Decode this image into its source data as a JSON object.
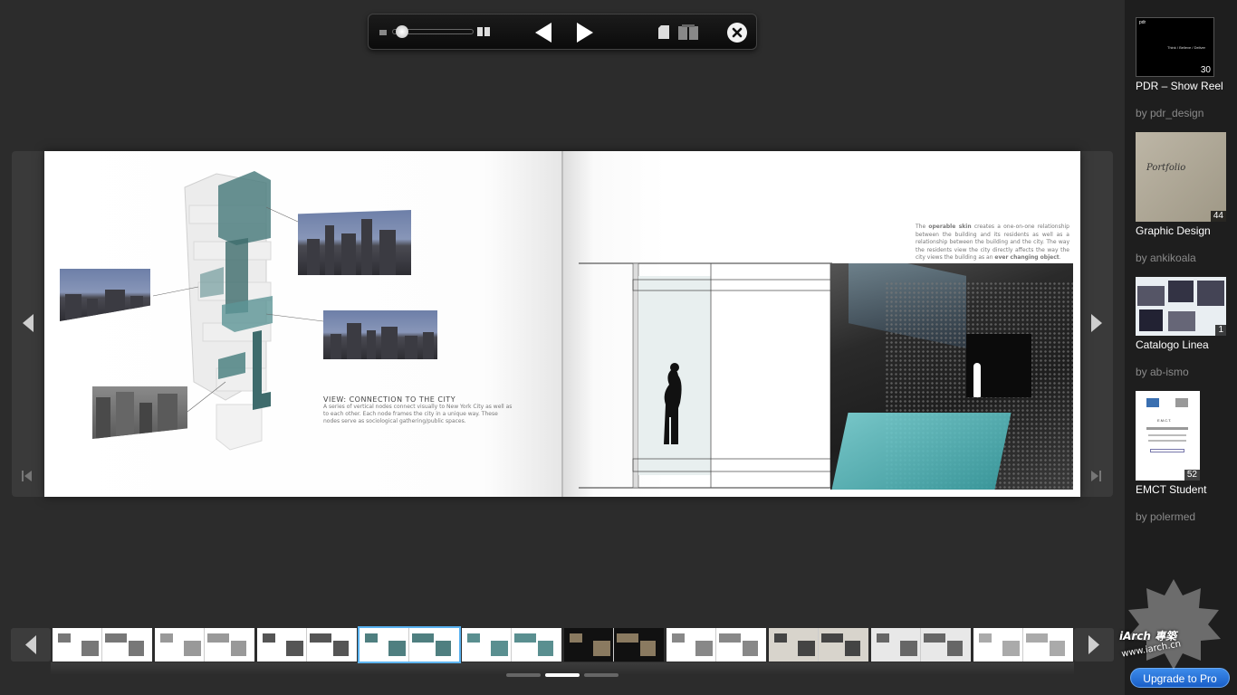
{
  "toolbar": {
    "zoom_level": 0.1,
    "icons": [
      "zoom-out-icon",
      "zoom-slider",
      "zoom-in-icon",
      "prev-page-icon",
      "next-page-icon",
      "single-page-icon",
      "two-page-icon",
      "close-icon"
    ]
  },
  "book": {
    "left_page": {
      "caption_title": "VIEW: CONNECTION TO THE CITY",
      "caption_text": "A series of vertical nodes connect visually to New York City as well as to each other. Each node frames the city in a unique way. These nodes serve as sociological gathering/public spaces."
    },
    "right_page": {
      "text_intro": "The ",
      "text_bold_1": "operable skin",
      "text_middle": " creates a one-on-one relationship between the building and its residents as well as a relationship between the building and the city. The way the residents view the city directly affects the way the city views the building as an ",
      "text_bold_2": "ever changing object",
      "text_end": "."
    }
  },
  "sidebar": {
    "items": [
      {
        "title": "PDR – Show Reel",
        "author": "by pdr_design",
        "count": "30",
        "thumb_text": "Think / Believe / Deliver",
        "thumb_logo": "pdr"
      },
      {
        "title": "Graphic Design",
        "author": "by ankikoala",
        "count": "44",
        "thumb_text": "Portfolio"
      },
      {
        "title": "Catalogo Linea",
        "author": "by ab-ismo",
        "count": "1"
      },
      {
        "title": "EMCT Student",
        "author": "by polermed",
        "count": "52",
        "thumb_text": "E.M.C.T."
      }
    ],
    "upgrade_label": "Upgrade to Pro"
  },
  "filmstrip": {
    "thumbnail_count": 10,
    "active_index": 3,
    "pager_count": 3,
    "pager_active": 1
  },
  "watermark": {
    "brand": "iArch 專築",
    "url": "www.iarch.cn"
  },
  "colors": {
    "background": "#2c2c2c",
    "sidebar": "#1e1e1e",
    "accent": "#2a6fd4",
    "active_thumb": "#58b2f0"
  }
}
